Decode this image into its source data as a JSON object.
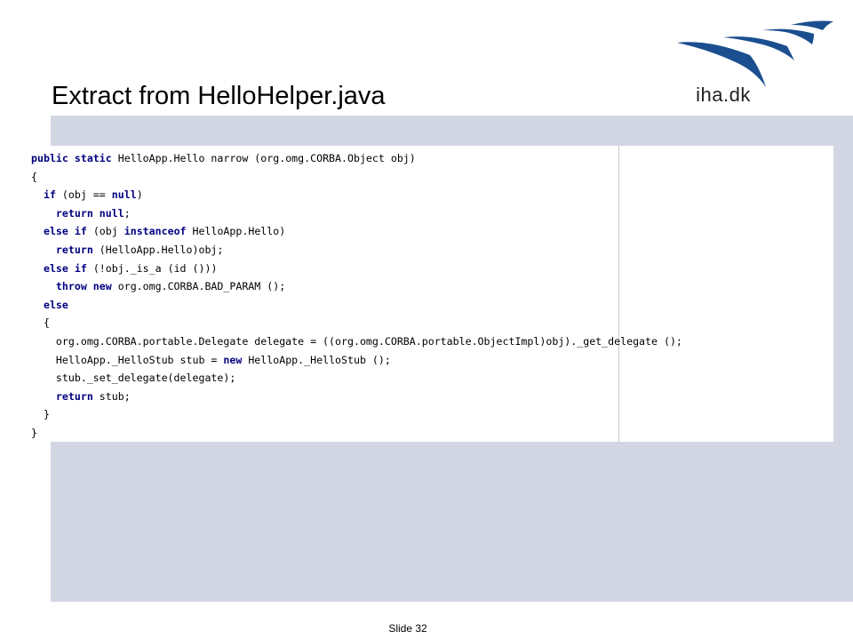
{
  "slide": {
    "title": "Extract from HelloHelper.java",
    "slide_number": "Slide 32"
  },
  "logo": {
    "text": "iha.dk",
    "color": "#1b4f8f"
  },
  "colors": {
    "panel_background": "#d3d7e4",
    "keyword": "#000080"
  },
  "code": {
    "lines": [
      [
        {
          "t": "public static",
          "kw": true
        },
        {
          "t": " HelloApp.Hello narrow (org.omg.CORBA.Object obj)"
        }
      ],
      [
        {
          "t": "{"
        }
      ],
      [
        {
          "t": "  "
        },
        {
          "t": "if",
          "kw": true
        },
        {
          "t": " (obj == "
        },
        {
          "t": "null",
          "kw": true
        },
        {
          "t": ")"
        }
      ],
      [
        {
          "t": "    "
        },
        {
          "t": "return null",
          "kw": true
        },
        {
          "t": ";"
        }
      ],
      [
        {
          "t": "  "
        },
        {
          "t": "else if",
          "kw": true
        },
        {
          "t": " (obj "
        },
        {
          "t": "instanceof",
          "kw": true
        },
        {
          "t": " HelloApp.Hello)"
        }
      ],
      [
        {
          "t": "    "
        },
        {
          "t": "return",
          "kw": true
        },
        {
          "t": " (HelloApp.Hello)obj;"
        }
      ],
      [
        {
          "t": "  "
        },
        {
          "t": "else if",
          "kw": true
        },
        {
          "t": " (!obj._is_a (id ()))"
        }
      ],
      [
        {
          "t": "    "
        },
        {
          "t": "throw new",
          "kw": true
        },
        {
          "t": " org.omg.CORBA.BAD_PARAM ();"
        }
      ],
      [
        {
          "t": "  "
        },
        {
          "t": "else",
          "kw": true
        }
      ],
      [
        {
          "t": "  {"
        }
      ],
      [
        {
          "t": "    org.omg.CORBA.portable.Delegate delegate = ((org.omg.CORBA.portable.ObjectImpl)obj)._get_delegate ();"
        }
      ],
      [
        {
          "t": "    HelloApp._HelloStub stub = "
        },
        {
          "t": "new",
          "kw": true
        },
        {
          "t": " HelloApp._HelloStub ();"
        }
      ],
      [
        {
          "t": "    stub._set_delegate(delegate);"
        }
      ],
      [
        {
          "t": "    "
        },
        {
          "t": "return",
          "kw": true
        },
        {
          "t": " stub;"
        }
      ],
      [
        {
          "t": "  }"
        }
      ],
      [
        {
          "t": "}"
        }
      ]
    ]
  }
}
